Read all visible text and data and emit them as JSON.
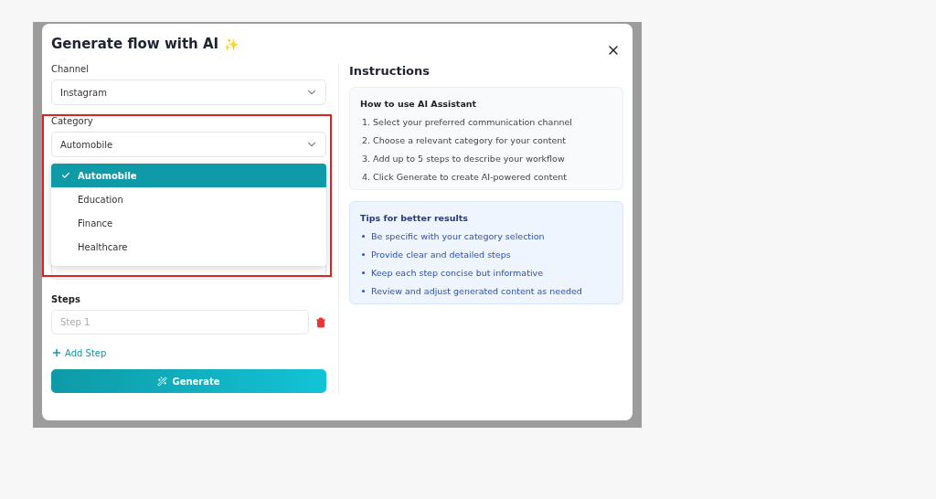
{
  "dialog": {
    "title": "Generate flow with AI",
    "title_emoji": "✨"
  },
  "channel": {
    "label": "Channel",
    "value": "Instagram"
  },
  "category": {
    "label": "Category",
    "value": "Automobile",
    "open": true,
    "options": [
      {
        "label": "Automobile",
        "selected": true
      },
      {
        "label": "Education",
        "selected": false
      },
      {
        "label": "Finance",
        "selected": false
      },
      {
        "label": "Healthcare",
        "selected": false
      }
    ]
  },
  "steps": {
    "label": "Steps",
    "items": [
      {
        "placeholder": "Step 1"
      }
    ],
    "add_label": "Add Step"
  },
  "generate_button": "Generate",
  "instructions": {
    "title": "Instructions",
    "how_to": {
      "title": "How to use AI Assistant",
      "items": [
        "1. Select your preferred communication channel",
        "2. Choose a relevant category for your content",
        "3. Add up to 5 steps to describe your workflow",
        "4. Click Generate to create AI-powered content"
      ]
    },
    "tips": {
      "title": "Tips for better results",
      "items": [
        "Be specific with your category selection",
        "Provide clear and detailed steps",
        "Keep each step concise but informative",
        "Review and adjust generated content as needed"
      ]
    }
  },
  "highlight": true
}
